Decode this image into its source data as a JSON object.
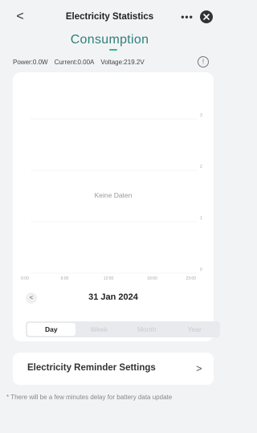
{
  "header": {
    "back_label": "<",
    "title": "Electricity Statistics",
    "more_label": "•••",
    "close_label": "✕"
  },
  "segment": {
    "label": "Consumption"
  },
  "readings": {
    "power": "Power:0.0W",
    "current": "Current:0.00A",
    "voltage": "Voltage:219.2V",
    "info_label": "!"
  },
  "chart_data": {
    "type": "line",
    "title": "",
    "xlabel": "",
    "ylabel": "",
    "x_ticks": [
      "0:00",
      "6:00",
      "12:00",
      "18:00",
      "23:00"
    ],
    "y_ticks": [
      "0",
      "1",
      "2",
      "3"
    ],
    "ylim": [
      0,
      3
    ],
    "series": [],
    "grid": true,
    "annotation": "Keine Daten"
  },
  "date": {
    "prev_label": "<",
    "label": "31 Jan 2024"
  },
  "period_tabs": [
    "Day",
    "Week",
    "Month",
    "Year"
  ],
  "period_selected": "Day",
  "reminder": {
    "label": "Electricity Reminder Settings",
    "chevron": ">"
  },
  "footnote": "* There will be a few minutes delay for battery data update",
  "colors": {
    "accent": "#2bbc8f",
    "segment_text": "#2f7f78",
    "background": "#f2f3f5"
  }
}
